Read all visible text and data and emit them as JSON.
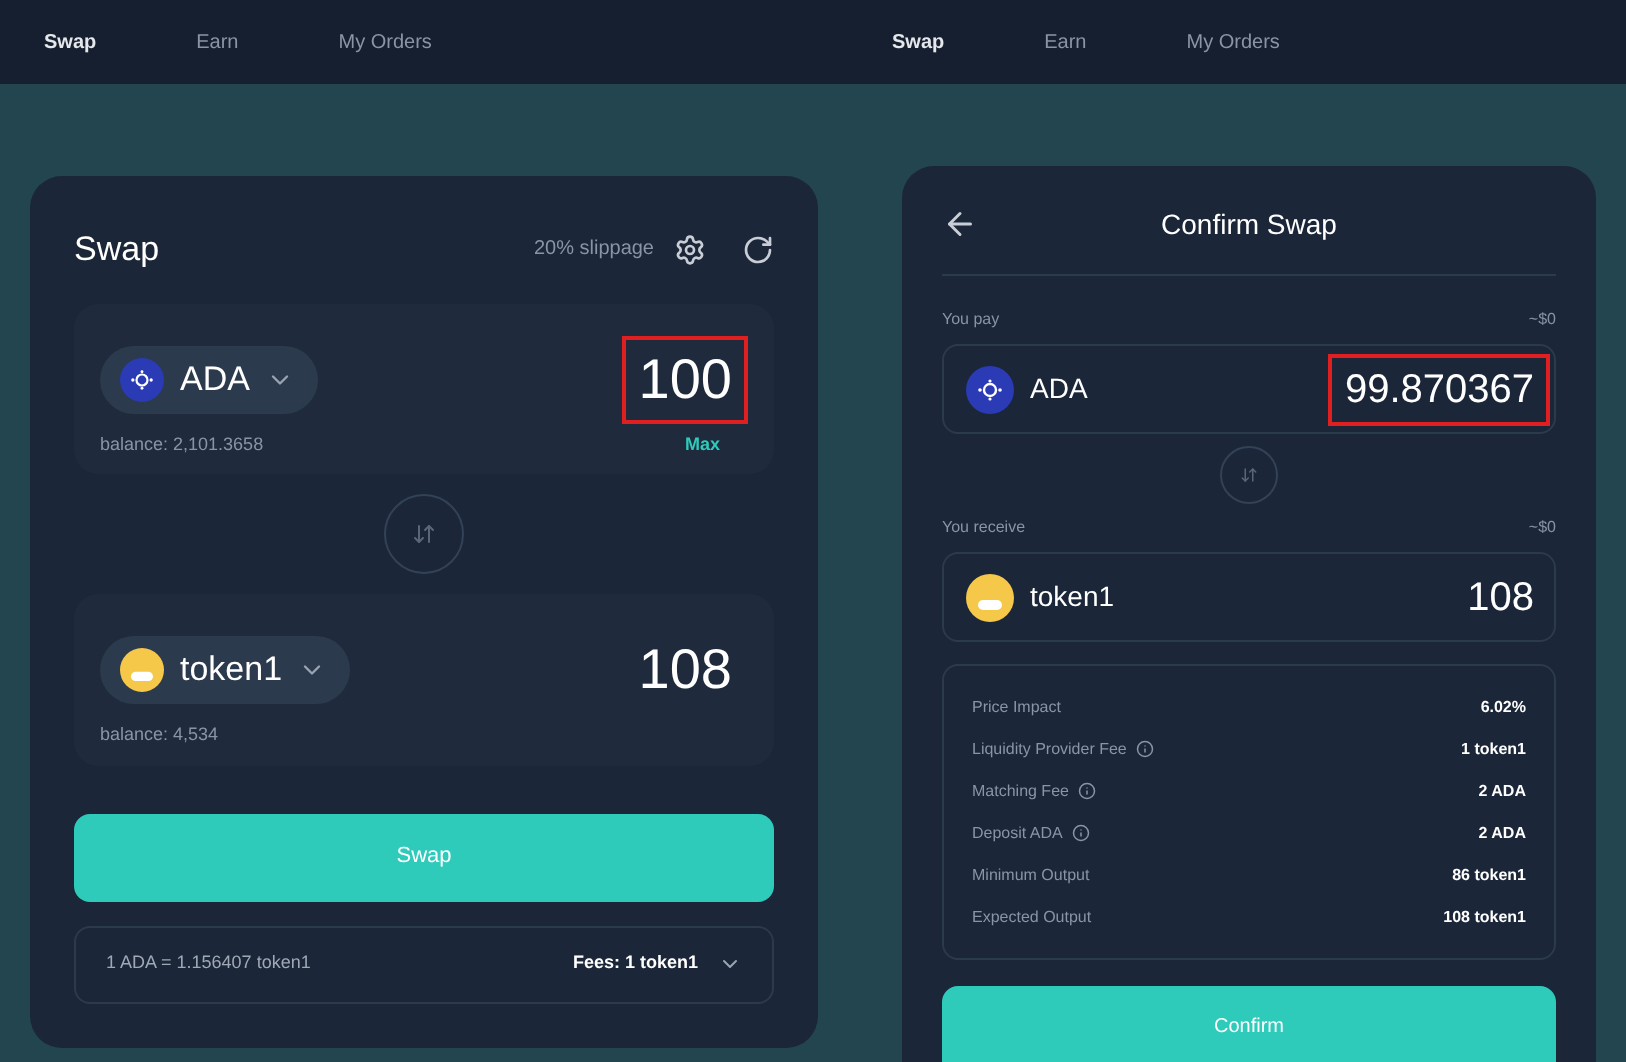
{
  "left": {
    "nav": [
      {
        "label": "Swap",
        "selected": true
      },
      {
        "label": "Earn",
        "selected": false
      },
      {
        "label": "My Orders",
        "selected": false
      }
    ],
    "title": "Swap",
    "slippage": "20% slippage",
    "from": {
      "kind": "ada",
      "token": "ADA",
      "amount": "100",
      "highlighted": true,
      "balance": "balance: 2,101.3658",
      "max": "Max"
    },
    "to": {
      "kind": "smiley",
      "token": "token1",
      "amount": "108",
      "highlighted": false,
      "balance": "balance: 4,534"
    },
    "button": "Swap",
    "rate": "1 ADA = 1.156407 token1",
    "fees": "Fees: 1 token1"
  },
  "right": {
    "nav": [
      {
        "label": "Swap",
        "selected": true
      },
      {
        "label": "Earn",
        "selected": false
      },
      {
        "label": "My Orders",
        "selected": false
      }
    ],
    "title": "Confirm Swap",
    "pay": {
      "label": "You pay",
      "usd": "~$0",
      "kind": "ada",
      "token": "ADA",
      "amount": "99.870367",
      "highlighted": true
    },
    "receive": {
      "label": "You receive",
      "usd": "~$0",
      "kind": "smiley",
      "token": "token1",
      "amount": "108",
      "highlighted": false
    },
    "details": [
      {
        "label": "Price Impact",
        "value": "6.02%",
        "info": false
      },
      {
        "label": "Liquidity Provider Fee",
        "value": "1 token1",
        "info": true
      },
      {
        "label": "Matching Fee",
        "value": "2 ADA",
        "info": true
      },
      {
        "label": "Deposit ADA",
        "value": "2 ADA",
        "info": true
      },
      {
        "label": "Minimum Output",
        "value": "86 token1",
        "info": false
      },
      {
        "label": "Expected Output",
        "value": "108 token1",
        "info": false
      }
    ],
    "button": "Confirm"
  }
}
